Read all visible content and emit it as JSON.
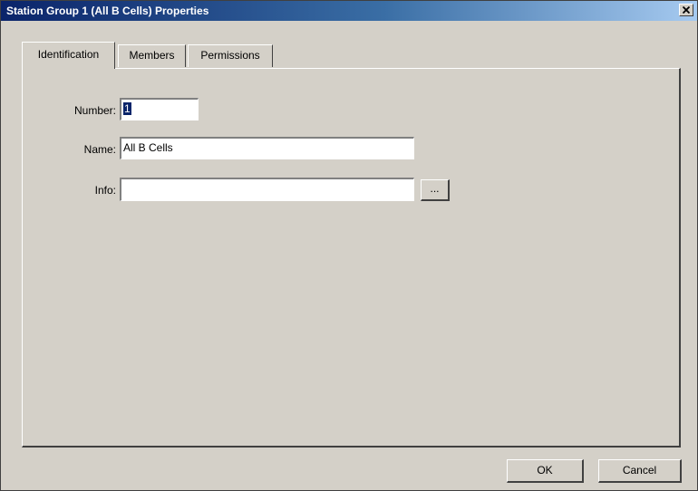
{
  "window": {
    "title": "Station Group 1 (All B Cells) Properties",
    "close_glyph": "✕"
  },
  "tabs": [
    {
      "label": "Identification",
      "active": true
    },
    {
      "label": "Members",
      "active": false
    },
    {
      "label": "Permissions",
      "active": false
    }
  ],
  "form": {
    "number_label": "Number:",
    "number_value": "1",
    "name_label": "Name:",
    "name_value": "All B Cells",
    "info_label": "Info:",
    "info_value": "",
    "browse_label": "..."
  },
  "buttons": {
    "ok_label": "OK",
    "cancel_label": "Cancel"
  }
}
